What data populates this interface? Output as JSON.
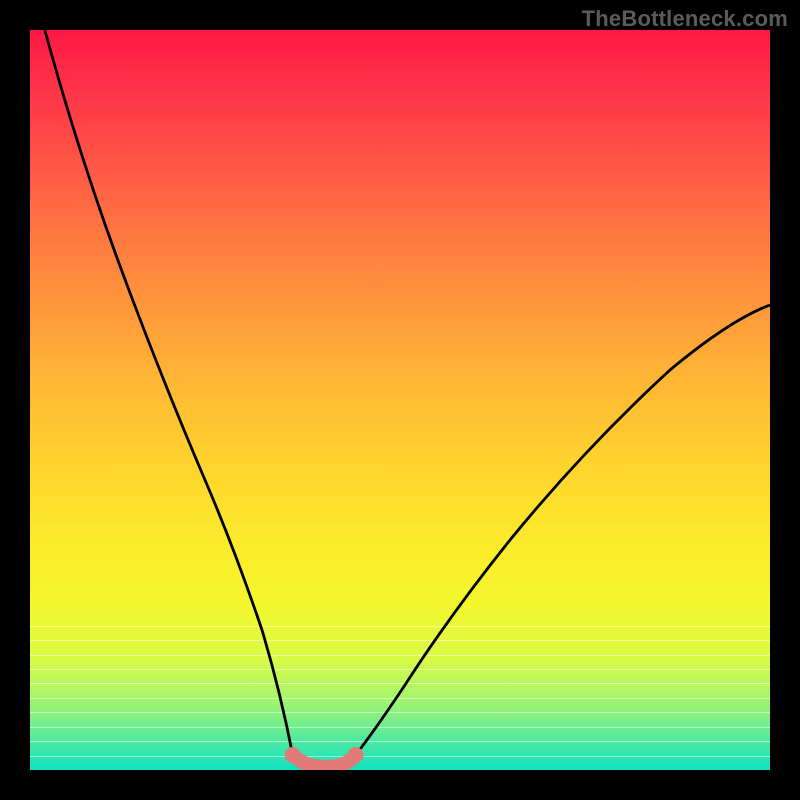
{
  "watermark": "TheBottleneck.com",
  "colors": {
    "bg": "#000000",
    "curve": "#000000",
    "highlight": "#e37a7a",
    "watermark": "#5b5b5b"
  },
  "chart_data": {
    "type": "line",
    "title": "",
    "xlabel": "",
    "ylabel": "",
    "xlim": [
      0,
      100
    ],
    "ylim": [
      0,
      100
    ],
    "grid": false,
    "series": [
      {
        "name": "left-curve",
        "x": [
          2,
          5,
          9,
          13,
          17,
          21,
          25,
          29,
          31.5,
          33.5,
          35.5
        ],
        "values": [
          100,
          87,
          72,
          58,
          46,
          35,
          25,
          15,
          9,
          5,
          2
        ]
      },
      {
        "name": "right-curve",
        "x": [
          44,
          47,
          50,
          54,
          60,
          68,
          78,
          90,
          100
        ],
        "values": [
          2,
          5,
          9,
          14,
          22,
          32,
          43,
          55,
          63
        ]
      },
      {
        "name": "bottom-highlight",
        "x": [
          35.5,
          36.5,
          37.5,
          38.5,
          40,
          41.5,
          43,
          44
        ],
        "values": [
          2,
          0.9,
          0.5,
          0.3,
          0.3,
          0.5,
          0.9,
          2
        ]
      }
    ],
    "notes": "Values are approximate percentages read from the vertical color gradient; no axis ticks or labels are rendered in the image. The pink/salmon 'bottom-highlight' segment is drawn thicker with round end caps and small end dots."
  }
}
